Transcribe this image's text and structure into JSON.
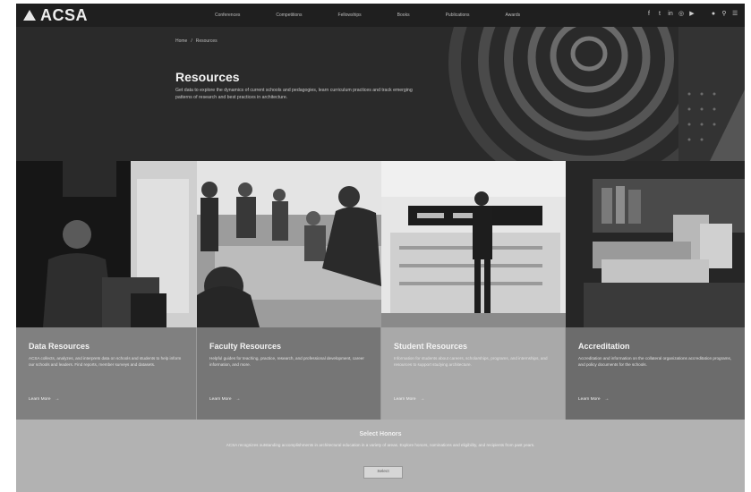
{
  "nav": {
    "logo_text": "ACSA",
    "links": [
      "Conferences",
      "Competitions",
      "Fellowships",
      "Books",
      "Publications",
      "Awards"
    ],
    "icons": [
      "facebook-icon",
      "twitter-icon",
      "linkedin-icon",
      "instagram-icon",
      "youtube-icon",
      "user-icon",
      "search-icon",
      "menu-icon"
    ]
  },
  "hero": {
    "breadcrumb": [
      "Home",
      "/",
      "Resources"
    ],
    "title": "Resources",
    "text": "Get data to explore the dynamics of current schools and pedagogies, learn curriculum practices and track emerging patterns of research and best practices in architecture."
  },
  "cards": [
    {
      "title": "Data Resources",
      "text": "ACSA collects, analyzes, and interprets data on schools and students to help inform our schools and leaders. Find reports, member surveys and datasets.",
      "link": "Learn More"
    },
    {
      "title": "Faculty Resources",
      "text": "Helpful guides for teaching, practice, research, and professional development, career information, and more.",
      "link": "Learn More"
    },
    {
      "title": "Student Resources",
      "text": "Information for students about careers, scholarships, programs, and internships, and resources to support studying architecture.",
      "link": "Learn More"
    },
    {
      "title": "Accreditation",
      "text": "Accreditation and information on the collateral organizations accreditation programs, and policy documents for the schools.",
      "link": "Learn More"
    }
  ],
  "select": {
    "title": "Select Honors",
    "text": "ACSA recognizes outstanding accomplishments in architectural education in a variety of areas. Explore honors, nominations and eligibility, and recipients from past years.",
    "button": "Select"
  },
  "colors": {
    "nav_bg": "#1f1f1f",
    "hero_bg": "#2b2b2b",
    "card_dark": "#6c6c6c",
    "card_light": "#a9a9a9"
  }
}
